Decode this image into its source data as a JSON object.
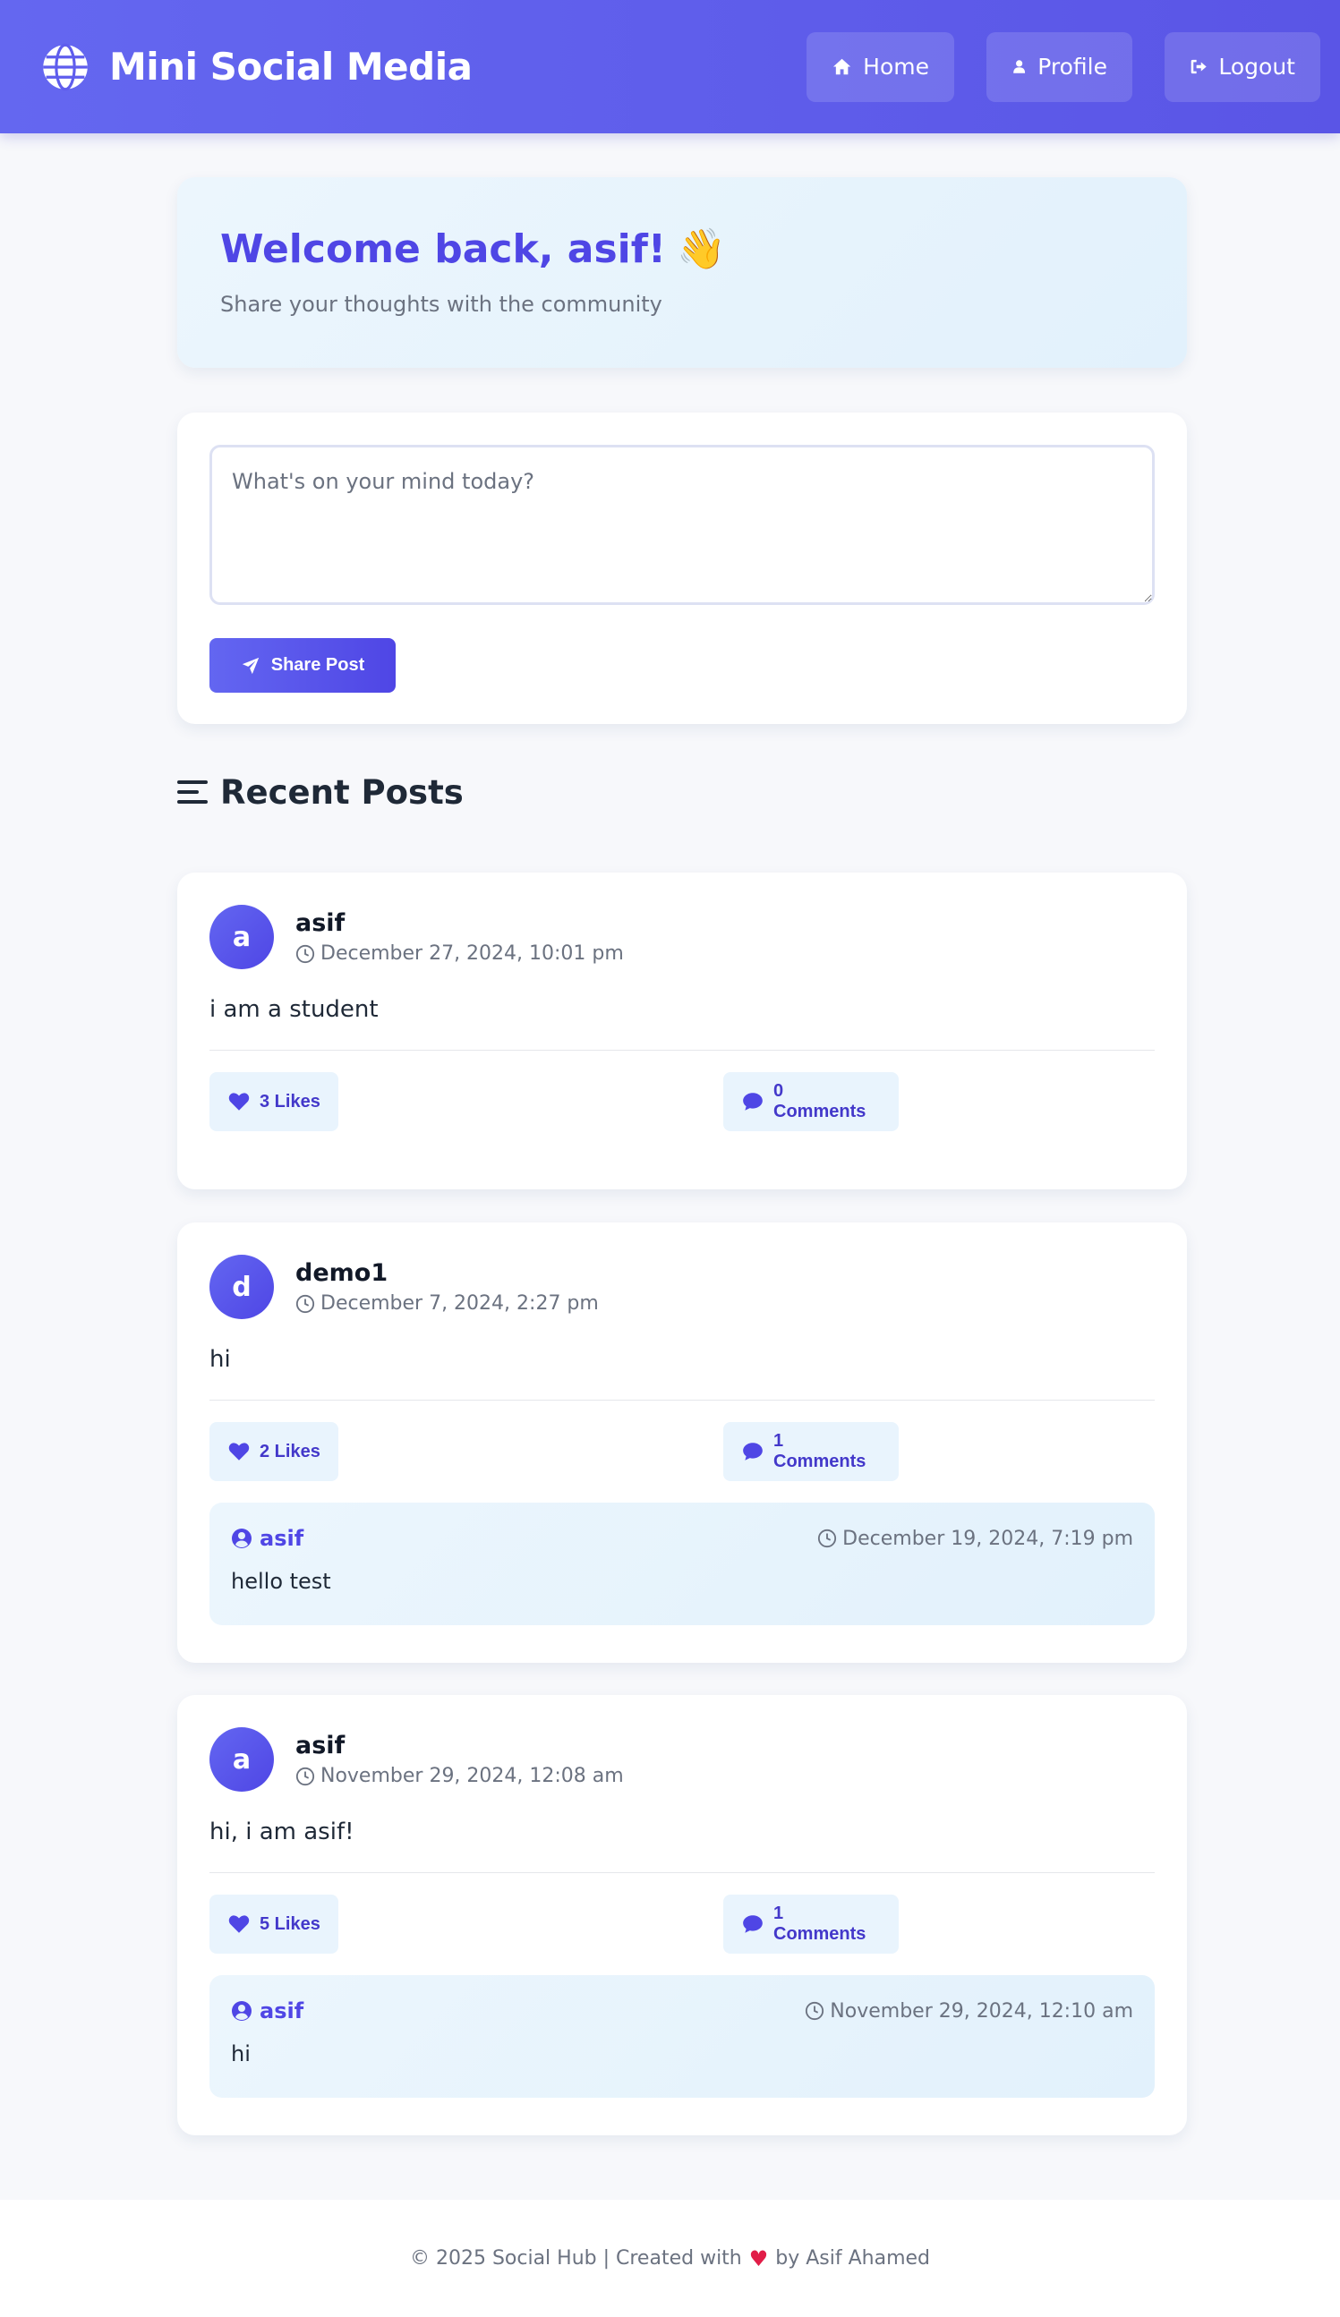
{
  "app": {
    "title": "Mini Social Media"
  },
  "nav": {
    "home": "Home",
    "profile": "Profile",
    "logout": "Logout"
  },
  "welcome": {
    "title": "Welcome back, asif!",
    "emoji": "👋",
    "subtitle": "Share your thoughts with the community"
  },
  "composer": {
    "placeholder": "What's on your mind today?",
    "value": "",
    "share_label": "Share Post"
  },
  "feed": {
    "heading": "Recent Posts"
  },
  "posts": [
    {
      "avatar": "a",
      "author": "asif",
      "time": "December 27, 2024, 10:01 pm",
      "body": "i am a student",
      "likes": "3 Likes",
      "comments": "0 Comments",
      "comment_list": []
    },
    {
      "avatar": "d",
      "author": "demo1",
      "time": "December 7, 2024, 2:27 pm",
      "body": "hi",
      "likes": "2 Likes",
      "comments": "1 Comments",
      "comment_list": [
        {
          "author": "asif",
          "time": "December 19, 2024, 7:19 pm",
          "text": "hello test"
        }
      ]
    },
    {
      "avatar": "a",
      "author": "asif",
      "time": "November 29, 2024, 12:08 am",
      "body": "hi, i am asif!",
      "likes": "5 Likes",
      "comments": "1 Comments",
      "comment_list": [
        {
          "author": "asif",
          "time": "November 29, 2024, 12:10 am",
          "text": "hi"
        }
      ]
    }
  ],
  "footer": {
    "left": "© 2025 Social Hub | Created with",
    "heart": "♥",
    "right": "by Asif Ahamed"
  },
  "colors": {
    "accent": "#4f46e5",
    "nav_bg": "#5f5ded",
    "heart": "#e11d48",
    "soft_blue": "#e9f4fd"
  },
  "icons": {
    "brand": "globe-icon",
    "home": "home-icon",
    "profile": "user-icon",
    "logout": "logout-icon",
    "share": "paper-plane-icon",
    "heading": "bars-icon",
    "like": "heart-icon",
    "comment": "comment-icon",
    "time": "clock-icon",
    "comment_author": "user-circle-icon"
  }
}
